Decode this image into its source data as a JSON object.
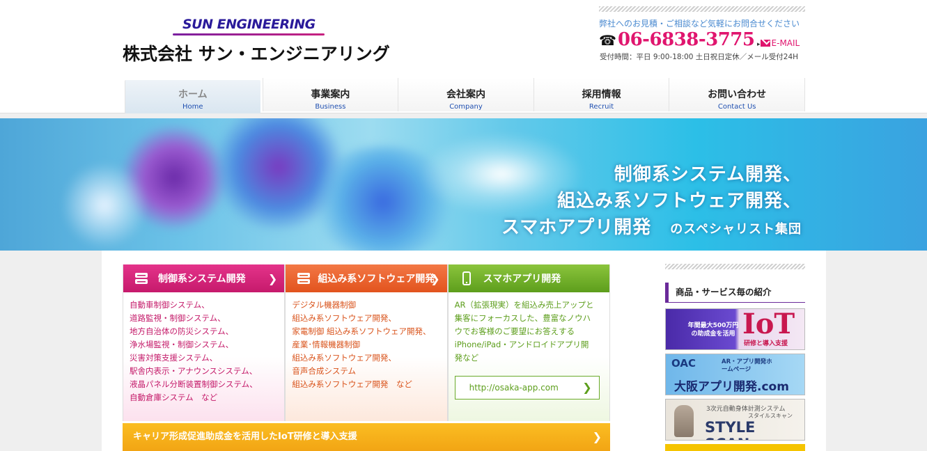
{
  "header": {
    "logo_en": "SUN ENGINEERING",
    "logo_ja": "株式会社 サン・エンジニアリング",
    "contact_message": "弊社へのお見積・ご相談など気軽にお問合せください",
    "phone": "06-6838-3775",
    "email_label": "E-MAIL",
    "hours": "受付時間：平日 9:00-18:00 土日祝日定休／メール受付24H"
  },
  "nav": [
    {
      "ja": "ホーム",
      "en": "Home"
    },
    {
      "ja": "事業案内",
      "en": "Business"
    },
    {
      "ja": "会社案内",
      "en": "Company"
    },
    {
      "ja": "採用情報",
      "en": "Recruit"
    },
    {
      "ja": "お問い合わせ",
      "en": "Contact Us"
    }
  ],
  "hero": {
    "line1": "制御系システム開発、",
    "line2": "組込み系ソフトウェア開発、",
    "line3_main": "スマホアプリ開発",
    "line3_sub": "のスペシャリスト集団"
  },
  "services": [
    {
      "title": "制御系システム開発",
      "items": [
        "自動車制御システム、",
        "道路監視・制御システム、",
        "地方自治体の防災システム、",
        "浄水場監視・制御システム、",
        "災害対策支援システム、",
        "駅舎内表示・アナウンスシステム、",
        "液晶パネル分断装置制御システム、",
        "自動倉庫システム　など"
      ]
    },
    {
      "title": "組込み系ソフトウェア開発",
      "items": [
        "デジタル機器制御",
        "組込み系ソフトウェア開発、",
        "家電制御 組込み系ソフトウェア開発、",
        "産業･情報機器制御",
        "組込み系ソフトウェア開発、",
        "音声合成システム",
        "組込み系ソフトウェア開発　など"
      ]
    },
    {
      "title": "スマホアプリ開発",
      "items": [
        "AR（拡張現実）を組込み売上アップと",
        "集客にフォーカスした、豊富なノウハ",
        "ウでお客様のご要望にお答えする",
        "iPhone/iPad・アンドロイドアプリ開",
        "発など"
      ],
      "link": "http://osaka-app.com"
    }
  ],
  "bottom_banner": "キャリア形成促進助成金を活用したIoT研修と導入支援",
  "sidebar": {
    "title": "商品・サービス毎の紹介",
    "banner1": {
      "small": "年間最大500万円の助成金を活用",
      "big": "IoT",
      "sub": "研修と導入支援"
    },
    "banner2": {
      "brand": "OAC",
      "tag": "AR・アプリ開発ホームページ",
      "big": "大阪アプリ開発.com"
    },
    "banner3": {
      "tag": "3次元自動身体計測システム",
      "kana": "スタイルスキャン",
      "big": "STYLE SCAN"
    }
  },
  "colors": {
    "magenta": "#e0156e",
    "orange": "#e2531e",
    "green": "#5d9e1c",
    "yellow": "#f2a514",
    "nav_blue": "#1f4fb0"
  }
}
